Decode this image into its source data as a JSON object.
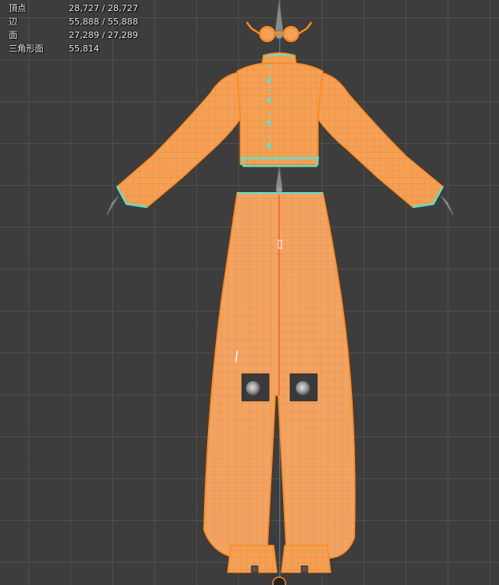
{
  "stats": {
    "rows": [
      {
        "label": "頂点",
        "value": "28,727 / 28,727"
      },
      {
        "label": "辺",
        "value": "55,888 / 55,888"
      },
      {
        "label": "面",
        "value": "27,289 / 27,289"
      },
      {
        "label": "三角形面",
        "value": "55,814"
      }
    ]
  },
  "colors": {
    "viewport_bg": "#3d3d3d",
    "mesh_fill": "#f2a15a",
    "wireframe": "#ff8a1c",
    "seam_edges": "#5fe0c8",
    "bone": "#8a8a8a",
    "axis_line": "#5a7fb8"
  },
  "icons": [
    "eyeglasses-object",
    "bone-gizmo",
    "light-gizmo",
    "camera-gizmo"
  ]
}
